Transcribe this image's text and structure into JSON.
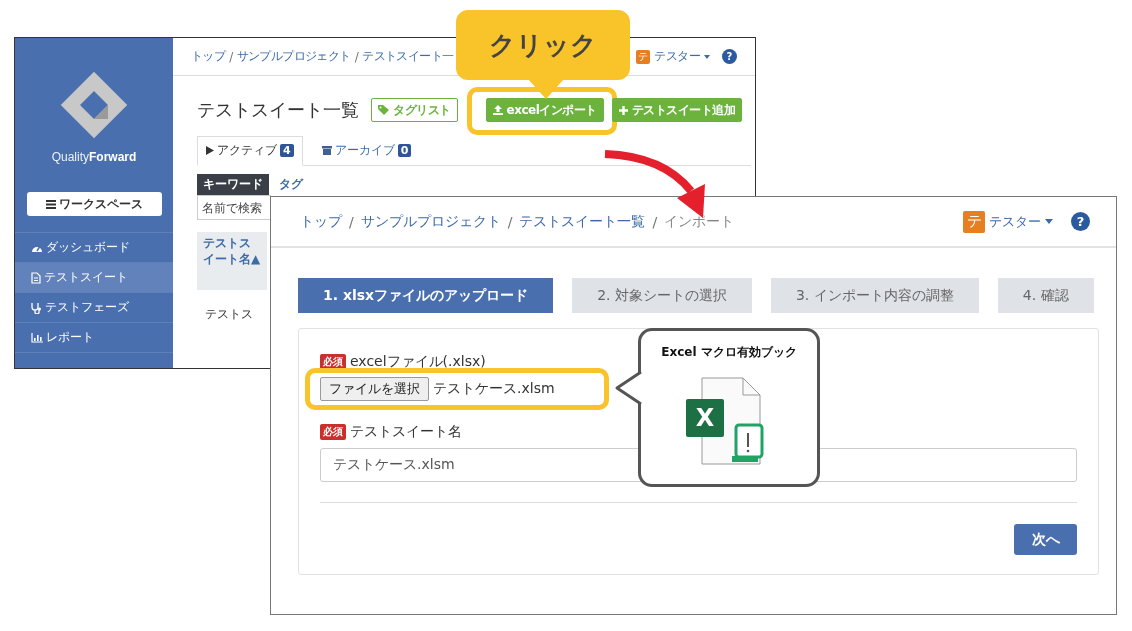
{
  "back_window": {
    "logo": {
      "light": "Quality",
      "bold": "Forward"
    },
    "workspace_button": "ワークスペース",
    "sidebar_items": [
      {
        "label": "ダッシュボード",
        "kind": "dashboard",
        "selected": false
      },
      {
        "label": "テストスイート",
        "kind": "suite",
        "selected": true
      },
      {
        "label": "テストフェーズ",
        "kind": "phase",
        "selected": false
      },
      {
        "label": "レポート",
        "kind": "report",
        "selected": false
      }
    ],
    "breadcrumb": [
      "トップ",
      "サンプルプロジェクト",
      "テストスイート一"
    ],
    "separator": "/",
    "user": {
      "avatar": "テ",
      "name": "テスター"
    },
    "help": "?",
    "page_title": "テストスイート一覧",
    "buttons": [
      {
        "label": "タグリスト",
        "kind": "tag",
        "highlighted": false
      },
      {
        "label": "excelインポート",
        "kind": "import",
        "highlighted": true
      },
      {
        "label": "テストスイート追加",
        "kind": "add",
        "highlighted": false
      }
    ],
    "tabs": [
      {
        "label": "アクティブ",
        "count": "4",
        "kind": "active",
        "selected": true
      },
      {
        "label": "アーカイブ",
        "count": "0",
        "kind": "archive",
        "selected": false
      }
    ],
    "filter_tabs": [
      {
        "label": "キーワード",
        "selected": true
      },
      {
        "label": "タグ",
        "selected": false
      }
    ],
    "search": {
      "placeholder": "名前で検索"
    },
    "table": {
      "columns": [
        "テストスイート名▲"
      ],
      "rows": [
        [
          "テストス"
        ]
      ]
    }
  },
  "click_callout": {
    "label": "クリック"
  },
  "front_window": {
    "breadcrumb": [
      "トップ",
      "サンプルプロジェクト",
      "テストスイート一覧",
      "インポート"
    ],
    "separator": "/",
    "user": {
      "avatar": "テ",
      "name": "テスター"
    },
    "help": "?",
    "steps": [
      {
        "label": "1. xlsxファイルのアップロード",
        "selected": true
      },
      {
        "label": "2. 対象シートの選択",
        "selected": false
      },
      {
        "label": "3. インポート内容の調整",
        "selected": false
      },
      {
        "label": "4. 確認",
        "selected": false
      }
    ],
    "fields": [
      {
        "kind": "file",
        "required": "必須",
        "label": "excelファイル(.xlsx)",
        "button": "ファイルを選択",
        "value": "テストケース.xlsm",
        "highlighted": true
      },
      {
        "kind": "text",
        "required": "必須",
        "label": "テストスイート名",
        "value": "テストケース.xlsm",
        "highlighted": false
      }
    ],
    "next_button": "次へ"
  },
  "file_callout": {
    "title": "Excel マクロ有効ブック",
    "icon_letter": "X"
  }
}
